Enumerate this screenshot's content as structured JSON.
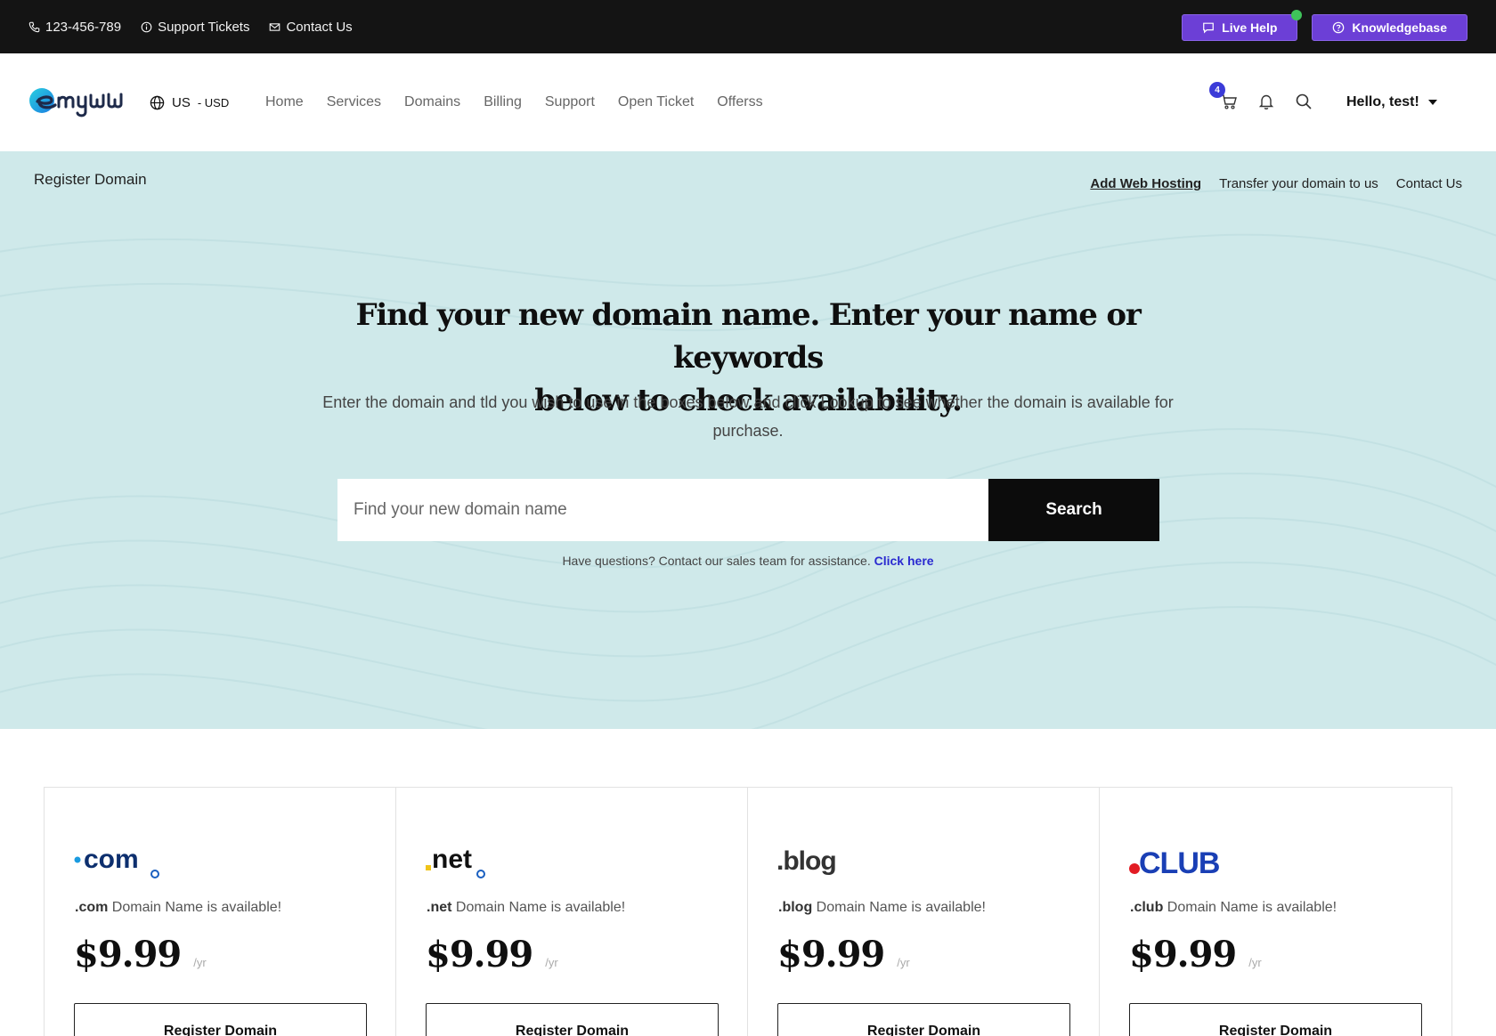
{
  "topbar": {
    "phone": "123-456-789",
    "support_tickets": "Support Tickets",
    "contact_us": "Contact Us",
    "live_help": "Live Help",
    "knowledgebase": "Knowledgebase"
  },
  "navbar": {
    "locale_country": "US",
    "locale_currency": "- USD",
    "menu": [
      "Home",
      "Services",
      "Domains",
      "Billing",
      "Support",
      "Open Ticket",
      "Offerss"
    ],
    "cart_count": "4",
    "user_greeting": "Hello, test!"
  },
  "hero": {
    "breadcrumb": "Register Domain",
    "links": [
      "Add Web Hosting",
      "Transfer your domain to us",
      "Contact Us"
    ],
    "title_line1": "Find your new domain name. Enter your name or keywords",
    "title_line2": "below to check availability.",
    "description": "Enter the domain and tld you wish to use in the boxes below and click Lookup to see whether the domain is available for purchase.",
    "search_placeholder": "Find your new domain name",
    "search_button": "Search",
    "help_text": "Have questions? Contact our sales team for assistance.",
    "help_link": "Click here"
  },
  "tlds": [
    {
      "tld": ".com",
      "logo_text": "com",
      "avail_suffix": " Domain Name is available!",
      "price": "$9.99",
      "per": "/yr",
      "button": "Register Domain"
    },
    {
      "tld": ".net",
      "logo_text": "net",
      "avail_suffix": " Domain Name is available!",
      "price": "$9.99",
      "per": "/yr",
      "button": "Register Domain"
    },
    {
      "tld": ".blog",
      "logo_text": ".blog",
      "avail_suffix": " Domain Name is available!",
      "price": "$9.99",
      "per": "/yr",
      "button": "Register Domain"
    },
    {
      "tld": ".club",
      "logo_text": "CLUB",
      "avail_suffix": " Domain Name is available!",
      "price": "$9.99",
      "per": "/yr",
      "button": "Register Domain"
    }
  ],
  "colors": {
    "topbar_bg": "#141414",
    "accent_purple": "#6c3fd6",
    "hero_bg": "#cfe9ea",
    "link_blue": "#2a2ad0",
    "online_green": "#3fc25a"
  }
}
